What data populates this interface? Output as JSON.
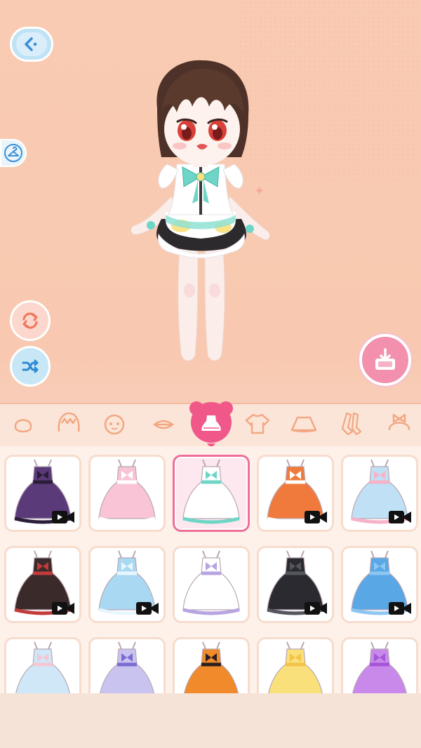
{
  "colors": {
    "background": "#f9cbb2",
    "accent_pink": "#f290ad",
    "selected_border": "#ef6f9a",
    "card_border": "#f7dccd",
    "button_blue": "#bfe2f4"
  },
  "toolbar": {
    "back_icon": "back-arrow-icon",
    "wardrobe_icon": "hanger-icon",
    "rotate_icon": "rotate-icon",
    "shuffle_icon": "shuffle-icon",
    "save_icon": "save-download-icon"
  },
  "categories": [
    {
      "icon": "face-icon",
      "active": false
    },
    {
      "icon": "hair-icon",
      "active": false
    },
    {
      "icon": "expression-icon",
      "active": false
    },
    {
      "icon": "mouth-icon",
      "active": false
    },
    {
      "icon": "dress-icon",
      "active": true
    },
    {
      "icon": "top-icon",
      "active": false
    },
    {
      "icon": "skirt-icon",
      "active": false
    },
    {
      "icon": "socks-icon",
      "active": false
    },
    {
      "icon": "headwear-icon",
      "active": false
    }
  ],
  "outfits": [
    {
      "name": "purple-gothic-dress",
      "color": "#5b3a7a",
      "trim": "#2b1d3a",
      "video_locked": true,
      "selected": false
    },
    {
      "name": "pink-maid-dress",
      "color": "#f8c4d6",
      "trim": "#ffffff",
      "video_locked": false,
      "selected": false
    },
    {
      "name": "mint-ribbon-dress",
      "color": "#ffffff",
      "trim": "#6fd6c7",
      "video_locked": false,
      "selected": true
    },
    {
      "name": "orange-school-uniform",
      "color": "#f07a3c",
      "trim": "#ffffff",
      "video_locked": true,
      "selected": false
    },
    {
      "name": "pastel-lolita-dress",
      "color": "#bfe0f5",
      "trim": "#f6b3c8",
      "video_locked": true,
      "selected": false
    },
    {
      "name": "red-strawberry-dress",
      "color": "#3a2a2a",
      "trim": "#c23b3b",
      "video_locked": true,
      "selected": false
    },
    {
      "name": "blue-princess-gown",
      "color": "#a9d8f3",
      "trim": "#e8f6fd",
      "video_locked": true,
      "selected": false
    },
    {
      "name": "white-lace-dress",
      "color": "#ffffff",
      "trim": "#b7a4e0",
      "video_locked": false,
      "selected": false
    },
    {
      "name": "black-sparkle-dress",
      "color": "#2a2a30",
      "trim": "#55555f",
      "video_locked": true,
      "selected": false
    },
    {
      "name": "blue-feather-dress",
      "color": "#5aa7e6",
      "trim": "#8cc6f2",
      "video_locked": true,
      "selected": false
    },
    {
      "name": "pastel-bear-dress",
      "color": "#cfe7f7",
      "trim": "#f7c6d2",
      "video_locked": false,
      "selected": false
    },
    {
      "name": "lavender-ruffle-dress",
      "color": "#c9c3f0",
      "trim": "#7a6ad2",
      "video_locked": false,
      "selected": false
    },
    {
      "name": "halloween-pumpkin-dress",
      "color": "#f08a2a",
      "trim": "#2a1f1f",
      "video_locked": false,
      "selected": false
    },
    {
      "name": "yellow-ball-gown",
      "color": "#f9e07a",
      "trim": "#f2c44a",
      "video_locked": false,
      "selected": false
    },
    {
      "name": "violet-ball-gown",
      "color": "#c889ea",
      "trim": "#a455d8",
      "video_locked": false,
      "selected": false
    }
  ]
}
